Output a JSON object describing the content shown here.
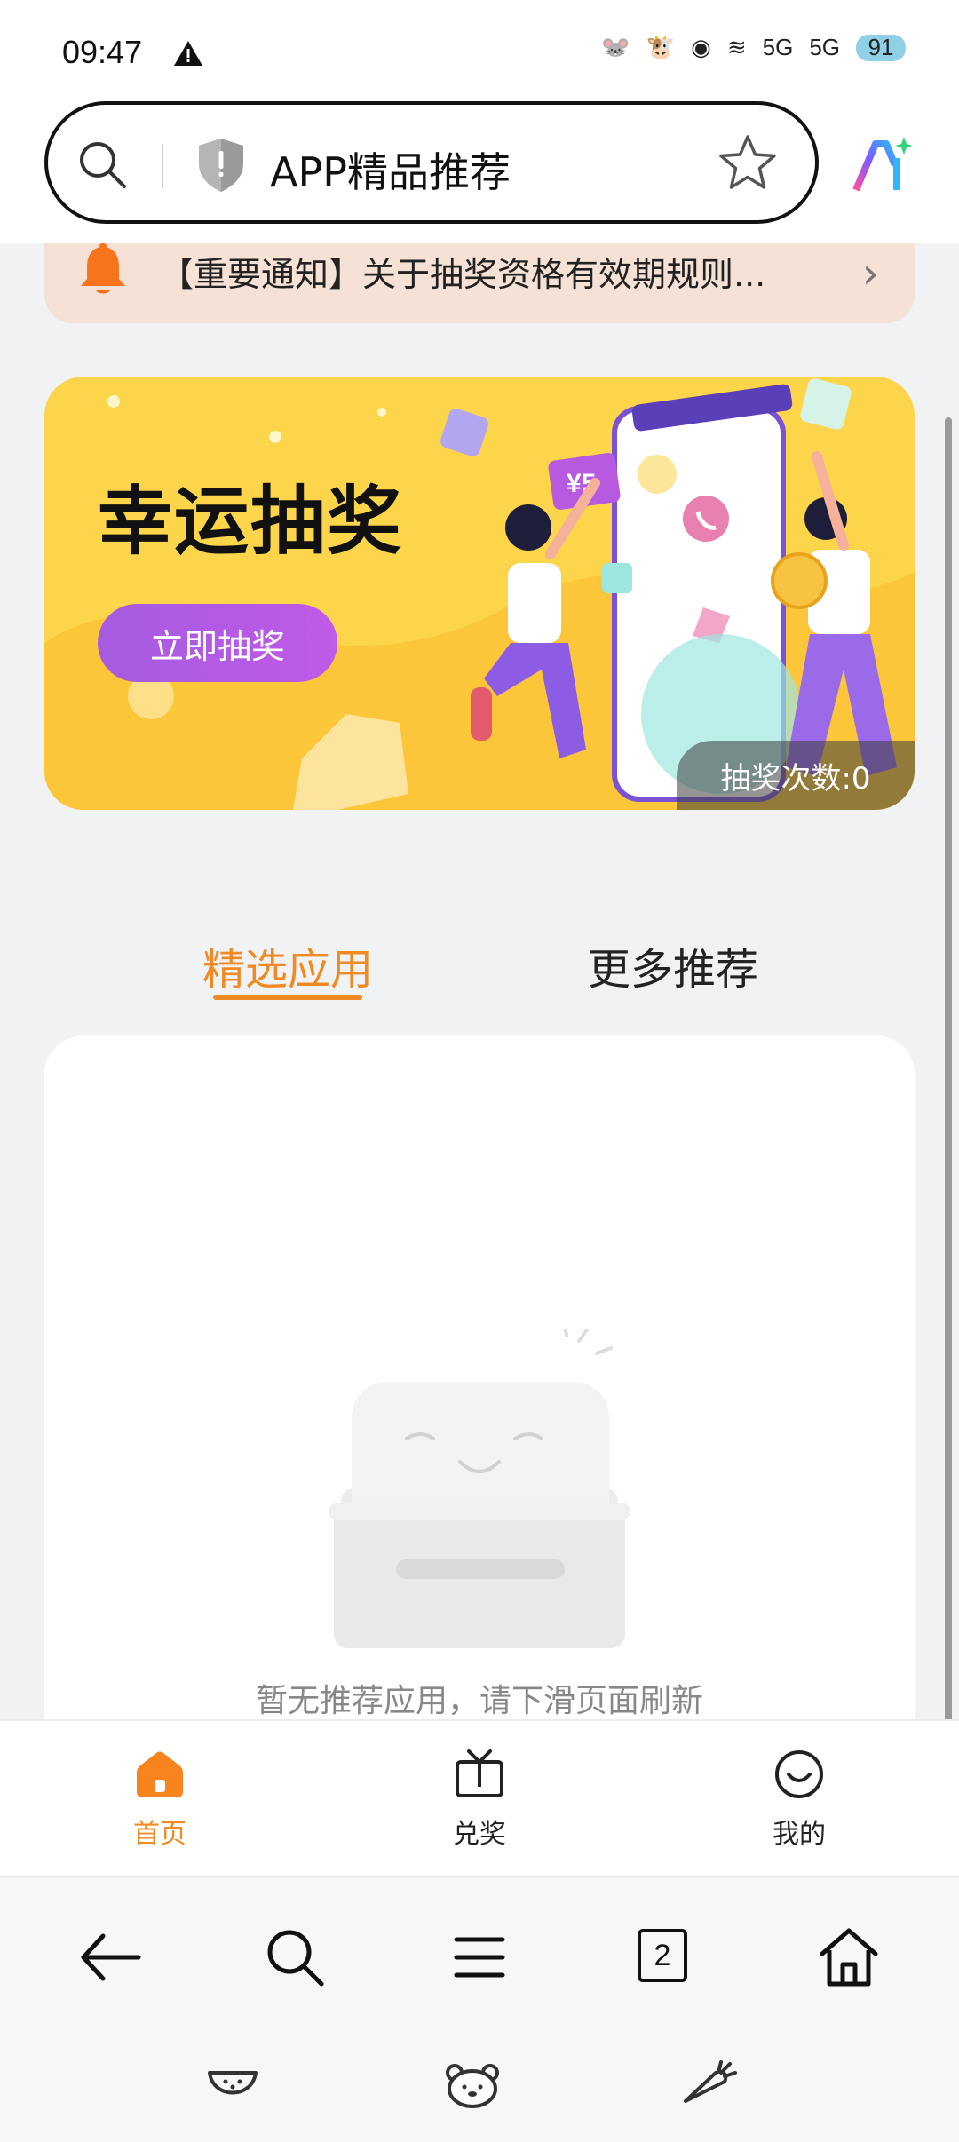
{
  "status_bar": {
    "time": "09:47",
    "battery": "91",
    "network_label_1": "5G",
    "network_label_2": "5G"
  },
  "address_bar": {
    "title": "APP精品推荐"
  },
  "notice": {
    "text": "【重要通知】关于抽奖资格有效期规则..."
  },
  "banner": {
    "title": "幸运抽奖",
    "button_label": "立即抽奖",
    "draw_count": "抽奖次数:0",
    "price_tag": "¥5"
  },
  "tabs": [
    {
      "label": "精选应用",
      "active": true
    },
    {
      "label": "更多推荐",
      "active": false
    }
  ],
  "empty_state": {
    "message": "暂无推荐应用，请下滑页面刷新"
  },
  "bottom_nav": [
    {
      "label": "首页",
      "icon": "home-icon",
      "active": true
    },
    {
      "label": "兑奖",
      "icon": "tv-gift-icon",
      "active": false
    },
    {
      "label": "我的",
      "icon": "smile-icon",
      "active": false
    }
  ],
  "browser_toolbar": {
    "tab_count": "2"
  },
  "colors": {
    "accent": "#f08a24",
    "banner_bg": "#fcd54a",
    "button_purple": "#b05ae4",
    "notice_bg": "#f5e1d6"
  }
}
